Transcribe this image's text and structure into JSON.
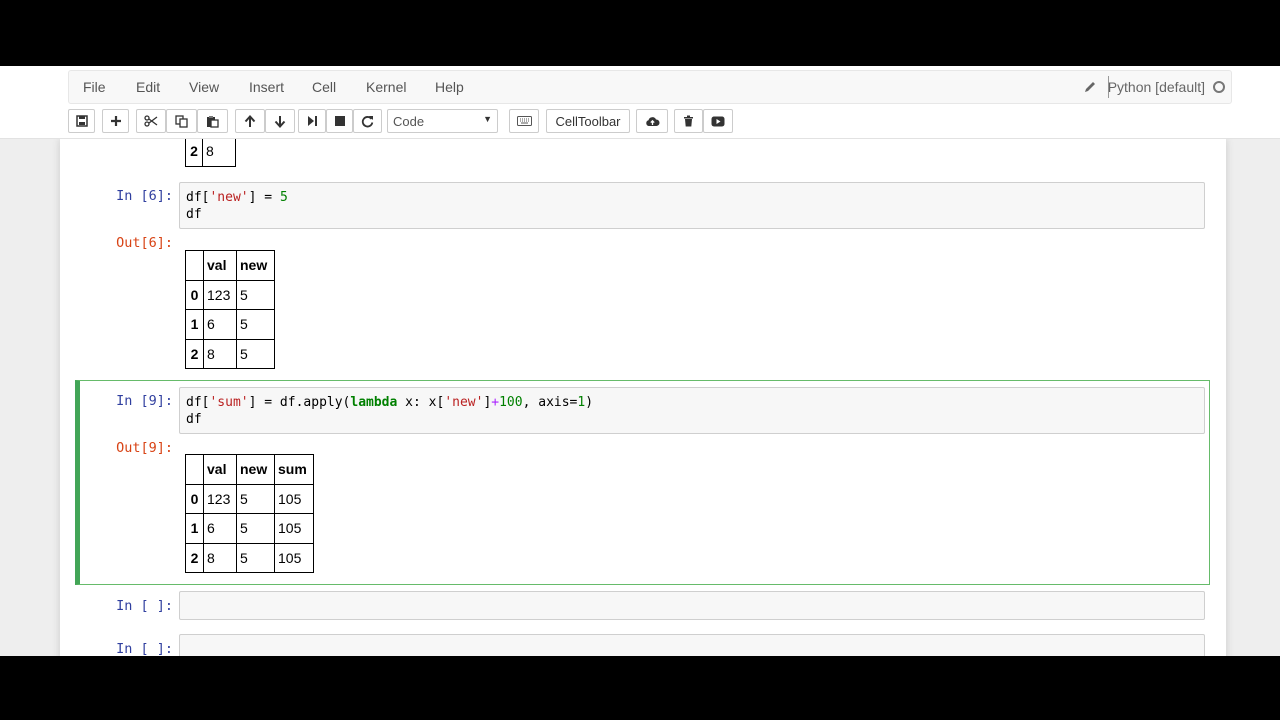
{
  "menu": [
    "File",
    "Edit",
    "View",
    "Insert",
    "Cell",
    "Kernel",
    "Help"
  ],
  "kernel": {
    "name": "Python [default]"
  },
  "toolbar": {
    "cell_type": "Code",
    "celltoolbar_label": "CellToolbar",
    "icons": [
      "save-icon",
      "plus-icon",
      "cut-icon",
      "copy-icon",
      "paste-icon",
      "move-up-icon",
      "move-down-icon",
      "run-next-icon",
      "stop-icon",
      "restart-icon",
      "keyboard-icon",
      "cloud-upload-icon",
      "trash-icon",
      "youtube-icon"
    ]
  },
  "cells": {
    "prev_row": {
      "index": "2",
      "val": "8"
    },
    "cell6": {
      "in_prompt": "In [6]:",
      "code_line1": {
        "a": "df[",
        "s": "'new'",
        "b": "] = ",
        "n": "5"
      },
      "code_line2": "df",
      "out_prompt": "Out[6]:",
      "table": {
        "headers": [
          "",
          "val",
          "new"
        ],
        "rows": [
          [
            "0",
            "123",
            "5"
          ],
          [
            "1",
            "6",
            "5"
          ],
          [
            "2",
            "8",
            "5"
          ]
        ]
      }
    },
    "cell9": {
      "in_prompt": "In [9]:",
      "code_line1": {
        "a": "df[",
        "s1": "'sum'",
        "b": "] = df.apply(",
        "kw": "lambda",
        "c": " x: x[",
        "s2": "'new'",
        "d": "]",
        "op": "+",
        "n1": "100",
        "e": ", axis=",
        "n2": "1",
        "f": ")"
      },
      "code_line2": "df",
      "out_prompt": "Out[9]:",
      "table": {
        "headers": [
          "",
          "val",
          "new",
          "sum"
        ],
        "rows": [
          [
            "0",
            "123",
            "5",
            "105"
          ],
          [
            "1",
            "6",
            "5",
            "105"
          ],
          [
            "2",
            "8",
            "5",
            "105"
          ]
        ]
      }
    },
    "empty1_prompt": "In [ ]:",
    "empty2_prompt": "In [ ]:"
  }
}
